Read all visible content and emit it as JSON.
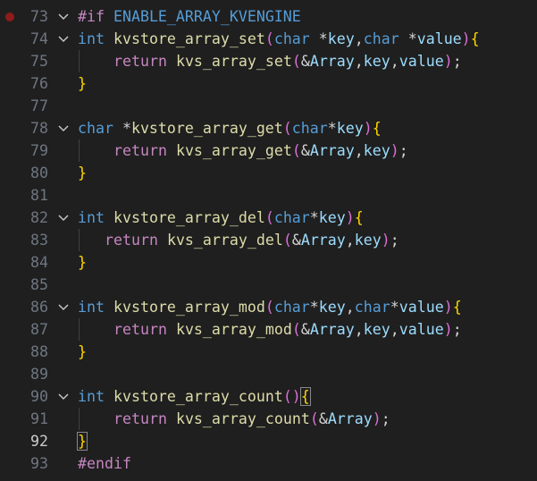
{
  "editor": {
    "theme": {
      "background": "#1f1f1f",
      "breakpoint": "#8f1b1b"
    },
    "lines": [
      {
        "num": "73",
        "breakpoint": true,
        "fold": true,
        "tokens": [
          [
            "dir",
            "#if"
          ],
          [
            "pun",
            " "
          ],
          [
            "macro",
            "ENABLE_ARRAY_KVENGINE"
          ]
        ]
      },
      {
        "num": "74",
        "fold": true,
        "tokens": [
          [
            "key",
            "int"
          ],
          [
            "pun",
            " "
          ],
          [
            "fn",
            "kvstore_array_set"
          ],
          [
            "p1",
            "("
          ],
          [
            "key",
            "char"
          ],
          [
            "pun",
            " *"
          ],
          [
            "id",
            "key"
          ],
          [
            "pun",
            ","
          ],
          [
            "key",
            "char"
          ],
          [
            "pun",
            " *"
          ],
          [
            "id",
            "value"
          ],
          [
            "p1",
            ")"
          ],
          [
            "p0",
            "{"
          ]
        ]
      },
      {
        "num": "75",
        "indent": 1,
        "tokens": [
          [
            "ctrl",
            "return"
          ],
          [
            "pun",
            " "
          ],
          [
            "fn",
            "kvs_array_set"
          ],
          [
            "p1",
            "("
          ],
          [
            "pun",
            "&"
          ],
          [
            "id",
            "Array"
          ],
          [
            "pun",
            ","
          ],
          [
            "id",
            "key"
          ],
          [
            "pun",
            ","
          ],
          [
            "id",
            "value"
          ],
          [
            "p1",
            ")"
          ],
          [
            "pun",
            ";"
          ]
        ]
      },
      {
        "num": "76",
        "tokens": [
          [
            "p0",
            "}"
          ]
        ]
      },
      {
        "num": "77",
        "tokens": []
      },
      {
        "num": "78",
        "fold": true,
        "tokens": [
          [
            "key",
            "char"
          ],
          [
            "pun",
            " *"
          ],
          [
            "fn",
            "kvstore_array_get"
          ],
          [
            "p1",
            "("
          ],
          [
            "key",
            "char"
          ],
          [
            "pun",
            "*"
          ],
          [
            "id",
            "key"
          ],
          [
            "p1",
            ")"
          ],
          [
            "p0",
            "{"
          ]
        ]
      },
      {
        "num": "79",
        "indent": 1,
        "tokens": [
          [
            "ctrl",
            "return"
          ],
          [
            "pun",
            " "
          ],
          [
            "fn",
            "kvs_array_get"
          ],
          [
            "p1",
            "("
          ],
          [
            "pun",
            "&"
          ],
          [
            "id",
            "Array"
          ],
          [
            "pun",
            ","
          ],
          [
            "id",
            "key"
          ],
          [
            "p1",
            ")"
          ],
          [
            "pun",
            ";"
          ]
        ]
      },
      {
        "num": "80",
        "tokens": [
          [
            "p0",
            "}"
          ]
        ]
      },
      {
        "num": "81",
        "tokens": []
      },
      {
        "num": "82",
        "fold": true,
        "tokens": [
          [
            "key",
            "int"
          ],
          [
            "pun",
            " "
          ],
          [
            "fn",
            "kvstore_array_del"
          ],
          [
            "p1",
            "("
          ],
          [
            "key",
            "char"
          ],
          [
            "pun",
            "*"
          ],
          [
            "id",
            "key"
          ],
          [
            "p1",
            ")"
          ],
          [
            "p0",
            "{"
          ]
        ]
      },
      {
        "num": "83",
        "indent": 2,
        "tokens": [
          [
            "ctrl",
            "return"
          ],
          [
            "pun",
            " "
          ],
          [
            "fn",
            "kvs_array_del"
          ],
          [
            "p1",
            "("
          ],
          [
            "pun",
            "&"
          ],
          [
            "id",
            "Array"
          ],
          [
            "pun",
            ","
          ],
          [
            "id",
            "key"
          ],
          [
            "p1",
            ")"
          ],
          [
            "pun",
            ";"
          ]
        ]
      },
      {
        "num": "84",
        "tokens": [
          [
            "p0",
            "}"
          ]
        ]
      },
      {
        "num": "85",
        "tokens": []
      },
      {
        "num": "86",
        "fold": true,
        "tokens": [
          [
            "key",
            "int"
          ],
          [
            "pun",
            " "
          ],
          [
            "fn",
            "kvstore_array_mod"
          ],
          [
            "p1",
            "("
          ],
          [
            "key",
            "char"
          ],
          [
            "pun",
            "*"
          ],
          [
            "id",
            "key"
          ],
          [
            "pun",
            ","
          ],
          [
            "key",
            "char"
          ],
          [
            "pun",
            "*"
          ],
          [
            "id",
            "value"
          ],
          [
            "p1",
            ")"
          ],
          [
            "p0",
            "{"
          ]
        ]
      },
      {
        "num": "87",
        "indent": 1,
        "tokens": [
          [
            "ctrl",
            "return"
          ],
          [
            "pun",
            " "
          ],
          [
            "fn",
            "kvs_array_mod"
          ],
          [
            "p1",
            "("
          ],
          [
            "pun",
            "&"
          ],
          [
            "id",
            "Array"
          ],
          [
            "pun",
            ","
          ],
          [
            "id",
            "key"
          ],
          [
            "pun",
            ","
          ],
          [
            "id",
            "value"
          ],
          [
            "p1",
            ")"
          ],
          [
            "pun",
            ";"
          ]
        ]
      },
      {
        "num": "88",
        "tokens": [
          [
            "p0",
            "}"
          ]
        ]
      },
      {
        "num": "89",
        "tokens": []
      },
      {
        "num": "90",
        "fold": true,
        "tokens": [
          [
            "key",
            "int"
          ],
          [
            "pun",
            " "
          ],
          [
            "fn",
            "kvstore_array_count"
          ],
          [
            "p1",
            "()"
          ],
          [
            "p0c",
            "{"
          ]
        ]
      },
      {
        "num": "91",
        "indent": 1,
        "tokens": [
          [
            "ctrl",
            "return"
          ],
          [
            "pun",
            " "
          ],
          [
            "fn",
            "kvs_array_count"
          ],
          [
            "p1",
            "("
          ],
          [
            "pun",
            "&"
          ],
          [
            "id",
            "Array"
          ],
          [
            "p1",
            ")"
          ],
          [
            "pun",
            ";"
          ]
        ]
      },
      {
        "num": "92",
        "current": true,
        "tokens": [
          [
            "p0c",
            "}"
          ]
        ]
      },
      {
        "num": "93",
        "tokens": [
          [
            "dir",
            "#endif"
          ]
        ]
      }
    ],
    "token_colors": {
      "key": "#569cd6",
      "ctrl": "#c586c0",
      "fn": "#dcdcaa",
      "id": "#9cdcfe",
      "macro": "#569cd6",
      "dir": "#c586c0",
      "pun": "#d4d4d4",
      "p0": "#ffd700",
      "p0c": "#ffd700",
      "p1": "#da70d6"
    }
  }
}
